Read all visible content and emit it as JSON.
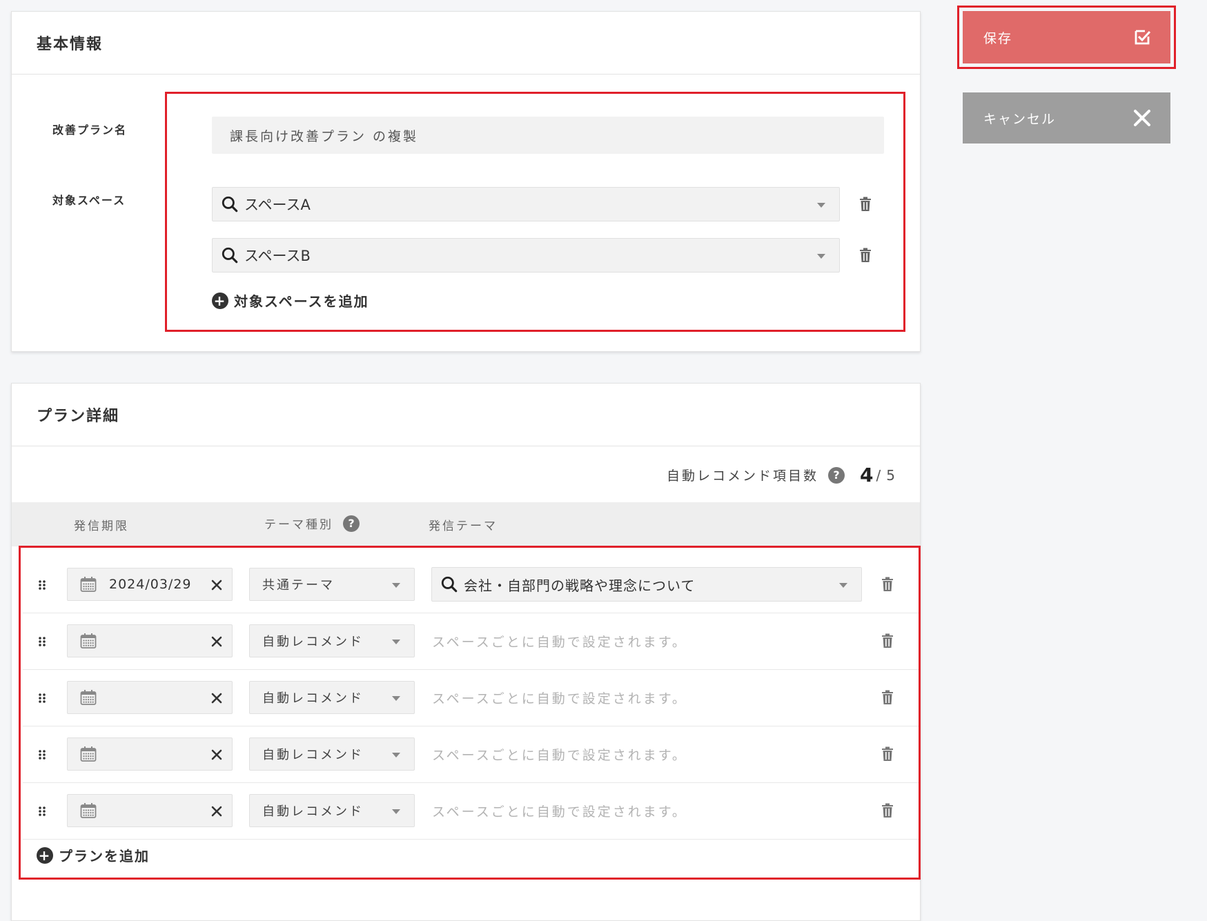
{
  "basic": {
    "title": "基本情報",
    "plan_name_label": "改善プラン名",
    "plan_name_value": "課長向け改善プラン の複製",
    "target_space_label": "対象スペース",
    "spaces": [
      "スペースA",
      "スペースB"
    ],
    "add_space_label": "対象スペースを追加"
  },
  "actions": {
    "save_label": "保存",
    "cancel_label": "キャンセル"
  },
  "plan": {
    "title": "プラン詳細",
    "auto_count_label": "自動レコメンド項目数",
    "auto_count_current": "4",
    "auto_count_sep": "/",
    "auto_count_max": "5",
    "columns": {
      "deadline": "発信期限",
      "theme_type": "テーマ種別",
      "theme": "発信テーマ"
    },
    "rows": [
      {
        "date": "2024/03/29",
        "type": "共通テーマ",
        "theme": "会社・自部門の戦略や理念について",
        "hint": ""
      },
      {
        "date": "",
        "type": "自動レコメンド",
        "theme": "",
        "hint": "スペースごとに自動で設定されます。"
      },
      {
        "date": "",
        "type": "自動レコメンド",
        "theme": "",
        "hint": "スペースごとに自動で設定されます。"
      },
      {
        "date": "",
        "type": "自動レコメンド",
        "theme": "",
        "hint": "スペースごとに自動で設定されます。"
      },
      {
        "date": "",
        "type": "自動レコメンド",
        "theme": "",
        "hint": "スペースごとに自動で設定されます。"
      }
    ],
    "add_plan_label": "プランを追加"
  },
  "colors": {
    "save": "#e06a69",
    "cancel": "#9e9e9e",
    "highlight": "#e0202a"
  }
}
